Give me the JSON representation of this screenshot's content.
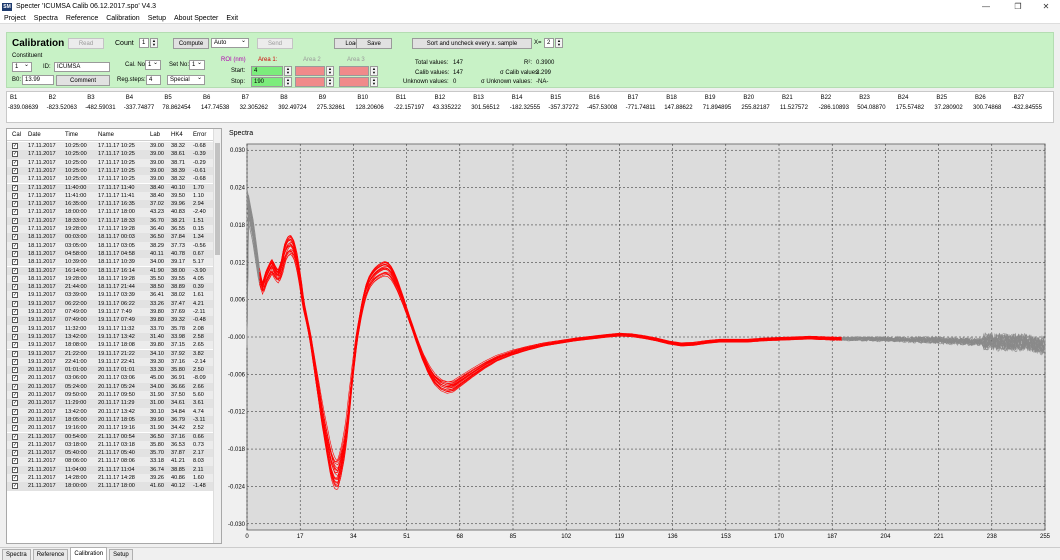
{
  "window": {
    "title": "Specter  'ICUMSA Calib 06.12.2017.spo'  V4.3",
    "icon": "SM"
  },
  "menu": [
    "Project",
    "Spectra",
    "Reference",
    "Calibration",
    "Setup",
    "About Specter",
    "Exit"
  ],
  "panel": {
    "title": "Calibration",
    "read": "Read",
    "count_label": "Count",
    "count_value": "1",
    "compute": "Compute",
    "compute_mode": "Auto",
    "send": "Send",
    "load": "Load",
    "save": "Save",
    "sort": "Sort and uncheck every x. sample",
    "x_label": "X=",
    "x_value": "2",
    "constituent_label": "Constituent",
    "constituent_value": "1",
    "id_label": "ID:",
    "id_value": "ICUMSA",
    "b0_label": "B0:",
    "b0_value": "13.99",
    "comment": "Comment",
    "calno_label": "Cal. No:",
    "calno_value": "1",
    "setno_label": "Set No:",
    "setno_value": "1",
    "regsteps_label": "Reg.steps:",
    "regsteps_value": "4",
    "special": "Special",
    "roi_label": "ROI (nm)",
    "area1": "Area 1:",
    "area2": "Area 2",
    "area3": "Area 3",
    "start_label": "Start:",
    "stop_label": "Stop:",
    "start_value": "4",
    "stop_value": "190",
    "total_label": "Total values:",
    "total_value": "147",
    "calib_label": "Calib values:",
    "calib_value": "147",
    "unknown_label": "Unknown values:",
    "unknown_value": "0",
    "r2_label": "R²:",
    "r2_value": "0.3900",
    "scalib_label": "σ Calib values:",
    "scalib_value": "3.299",
    "sunknown_label": "σ Unknown values:",
    "sunknown_value": "-NA-"
  },
  "bands": {
    "headers": [
      "B1",
      "B2",
      "B3",
      "B4",
      "B5",
      "B6",
      "B7",
      "B8",
      "B9",
      "B10",
      "B11",
      "B12",
      "B13",
      "B14",
      "B15",
      "B16",
      "B17",
      "B18",
      "B19",
      "B20",
      "B21",
      "B22",
      "B23",
      "B24",
      "B25",
      "B26",
      "B27"
    ],
    "values": [
      "-839.08639",
      "-823.52063",
      "-482.59031",
      "-337.74877",
      "78.862454",
      "147.74538",
      "32.305262",
      "392.49724",
      "275.32861",
      "128.20606",
      "-22.157197",
      "43.335222",
      "301.56512",
      "-182.32555",
      "-357.37272",
      "-457.53008",
      "-771.74811",
      "147.88622",
      "71.894895",
      "255.82187",
      "11.527572",
      "-286.10893",
      "504.08870",
      "175.57482",
      "37.280902",
      "300.74868",
      "-432.84555"
    ]
  },
  "table": {
    "columns": [
      "Cal",
      "Date",
      "Time",
      "Name",
      "Lab",
      "HK4",
      "Error"
    ],
    "rows": [
      [
        "17.11.2017",
        "10:25:00",
        "17.11.17 10:25",
        "39.00",
        "38.32",
        "-0.68"
      ],
      [
        "17.11.2017",
        "10:25:00",
        "17.11.17 10:25",
        "39.00",
        "38.61",
        "-0.39"
      ],
      [
        "17.11.2017",
        "10:25:00",
        "17.11.17 10:25",
        "39.00",
        "38.71",
        "-0.29"
      ],
      [
        "17.11.2017",
        "10:25:00",
        "17.11.17 10:25",
        "39.00",
        "38.39",
        "-0.61"
      ],
      [
        "17.11.2017",
        "10:25:00",
        "17.11.17 10:25",
        "39.00",
        "38.32",
        "-0.68"
      ],
      [
        "17.11.2017",
        "11:40:00",
        "17.11.17 11:40",
        "38.40",
        "40.10",
        "1.70"
      ],
      [
        "17.11.2017",
        "11:41:00",
        "17.11.17 11:41",
        "38.40",
        "39.50",
        "1.10"
      ],
      [
        "17.11.2017",
        "16:35:00",
        "17.11.17 16:35",
        "37.02",
        "39.96",
        "2.94"
      ],
      [
        "17.11.2017",
        "18:00:00",
        "17.11.17 18:00",
        "43.23",
        "40.83",
        "-2.40"
      ],
      [
        "17.11.2017",
        "18:33:00",
        "17.11.17 18:33",
        "36.70",
        "38.21",
        "1.51"
      ],
      [
        "17.11.2017",
        "19:28:00",
        "17.11.17 19:28",
        "36.40",
        "36.55",
        "0.15"
      ],
      [
        "18.11.2017",
        "00:03:00",
        "18.11.17 00:03",
        "36.50",
        "37.84",
        "1.34"
      ],
      [
        "18.11.2017",
        "03:05:00",
        "18.11.17 03:05",
        "38.29",
        "37.73",
        "-0.56"
      ],
      [
        "18.11.2017",
        "04:58:00",
        "18.11.17 04:58",
        "40.11",
        "40.78",
        "0.67"
      ],
      [
        "18.11.2017",
        "10:39:00",
        "18.11.17 10:39",
        "34.00",
        "39.17",
        "5.17"
      ],
      [
        "18.11.2017",
        "16:14:00",
        "18.11.17 16:14",
        "41.90",
        "38.00",
        "-3.90"
      ],
      [
        "18.11.2017",
        "19:28:00",
        "18.11.17 19:28",
        "35.50",
        "39.55",
        "4.05"
      ],
      [
        "18.11.2017",
        "21:44:00",
        "18.11.17 21:44",
        "38.50",
        "38.89",
        "0.39"
      ],
      [
        "19.11.2017",
        "03:39:00",
        "19.11.17 03:39",
        "36.41",
        "38.02",
        "1.61"
      ],
      [
        "19.11.2017",
        "06:22:00",
        "19.11.17 06:22",
        "33.26",
        "37.47",
        "4.21"
      ],
      [
        "19.11.2017",
        "07:49:00",
        "19.11.17 7:49",
        "39.80",
        "37.69",
        "-2.11"
      ],
      [
        "19.11.2017",
        "07:49:00",
        "19.11.17 07:49",
        "39.80",
        "39.32",
        "-0.48"
      ],
      [
        "19.11.2017",
        "11:32:00",
        "19.11.17 11:32",
        "33.70",
        "35.78",
        "2.08"
      ],
      [
        "19.11.2017",
        "13:42:00",
        "19.11.17 13:42",
        "31.40",
        "33.98",
        "2.58"
      ],
      [
        "19.11.2017",
        "18:08:00",
        "19.11.17 18:08",
        "39.80",
        "37.15",
        "2.65"
      ],
      [
        "19.11.2017",
        "21:22:00",
        "19.11.17 21:22",
        "34.10",
        "37.92",
        "3.82"
      ],
      [
        "19.11.2017",
        "22:41:00",
        "19.11.17 22:41",
        "39.30",
        "37.16",
        "-2.14"
      ],
      [
        "20.11.2017",
        "01:01:00",
        "20.11.17 01:01",
        "33.30",
        "35.80",
        "2.50"
      ],
      [
        "20.11.2017",
        "03:06:00",
        "20.11.17 03:06",
        "45.00",
        "36.91",
        "-8.09"
      ],
      [
        "20.11.2017",
        "05:24:00",
        "20.11.17 05:24",
        "34.00",
        "36.66",
        "2.66"
      ],
      [
        "20.11.2017",
        "09:50:00",
        "20.11.17 09:50",
        "31.90",
        "37.50",
        "5.60"
      ],
      [
        "20.11.2017",
        "11:29:00",
        "20.11.17 11:29",
        "31.00",
        "34.61",
        "3.61"
      ],
      [
        "20.11.2017",
        "13:42:00",
        "20.11.17 13:42",
        "30.10",
        "34.84",
        "4.74"
      ],
      [
        "20.11.2017",
        "18:05:00",
        "20.11.17 18:05",
        "39.90",
        "36.79",
        "-3.11"
      ],
      [
        "20.11.2017",
        "19:16:00",
        "20.11.17 19:16",
        "31.90",
        "34.42",
        "2.52"
      ],
      [
        "21.11.2017",
        "00:54:00",
        "21.11.17 00:54",
        "36.50",
        "37.16",
        "0.66"
      ],
      [
        "21.11.2017",
        "03:18:00",
        "21.11.17 03:18",
        "35.80",
        "36.53",
        "0.73"
      ],
      [
        "21.11.2017",
        "05:40:00",
        "21.11.17 05:40",
        "35.70",
        "37.87",
        "2.17"
      ],
      [
        "21.11.2017",
        "08:06:00",
        "21.11.17 08:06",
        "33.18",
        "41.21",
        "8.03"
      ],
      [
        "21.11.2017",
        "11:04:00",
        "21.11.17 11:04",
        "36.74",
        "38.85",
        "2.11"
      ],
      [
        "21.11.2017",
        "14:28:00",
        "21.11.17 14:28",
        "39.26",
        "40.86",
        "1.60"
      ],
      [
        "21.11.2017",
        "18:00:00",
        "21.11.17 18:00",
        "41.60",
        "40.12",
        "-1.48"
      ]
    ]
  },
  "chart_data": {
    "type": "line",
    "title": "Spectra",
    "xlim": [
      0,
      255
    ],
    "ylim": [
      -0.031,
      0.031
    ],
    "xticks": [
      0,
      17,
      34,
      51,
      68,
      85,
      102,
      119,
      136,
      153,
      170,
      187,
      204,
      221,
      238,
      255
    ],
    "yticks": [
      0.03,
      0.024,
      0.018,
      0.012,
      0.006,
      0.0,
      -0.006,
      -0.012,
      -0.018,
      -0.024,
      -0.03
    ],
    "yticklabels": [
      "0.030",
      "0.024",
      "0.018",
      "0.012",
      "0.006",
      "-0.000",
      "-0.006",
      "-0.012",
      "-0.018",
      "-0.024",
      "-0.030"
    ],
    "roi": [
      4,
      190
    ],
    "series_color": "#ff0000",
    "outside_color": "#8a8a8a",
    "curve": [
      [
        0,
        0.022
      ],
      [
        2,
        0.017
      ],
      [
        4,
        0.0098
      ],
      [
        5,
        0.0078
      ],
      [
        6,
        0.0095
      ],
      [
        8,
        0.0115
      ],
      [
        9,
        0.0105
      ],
      [
        10,
        0.0098
      ],
      [
        11,
        0.011
      ],
      [
        12,
        0.0135
      ],
      [
        13,
        0.0146
      ],
      [
        14,
        0.015
      ],
      [
        15,
        0.0142
      ],
      [
        16,
        0.0122
      ],
      [
        17,
        0.0093
      ],
      [
        18,
        0.0055
      ],
      [
        20,
        0.0005
      ],
      [
        22,
        -0.006
      ],
      [
        24,
        -0.0125
      ],
      [
        26,
        -0.018
      ],
      [
        27,
        -0.0205
      ],
      [
        28,
        -0.0219
      ],
      [
        29,
        -0.0222
      ],
      [
        30,
        -0.0205
      ],
      [
        31,
        -0.018
      ],
      [
        32,
        -0.0145
      ],
      [
        33,
        -0.0095
      ],
      [
        34,
        -0.0048
      ],
      [
        35,
        -0.0005
      ],
      [
        36,
        0.0028
      ],
      [
        37,
        0.0055
      ],
      [
        38,
        0.0075
      ],
      [
        39,
        0.0088
      ],
      [
        40,
        0.0096
      ],
      [
        41,
        0.0102
      ],
      [
        42,
        0.0106
      ],
      [
        43,
        0.0109
      ],
      [
        44,
        0.0111
      ],
      [
        45,
        0.011
      ],
      [
        46,
        0.0105
      ],
      [
        47,
        0.0096
      ],
      [
        48,
        0.0085
      ],
      [
        50,
        0.0058
      ],
      [
        52,
        0.0028
      ],
      [
        54,
        -0.0002
      ],
      [
        56,
        -0.003
      ],
      [
        58,
        -0.0052
      ],
      [
        60,
        -0.0068
      ],
      [
        62,
        -0.0077
      ],
      [
        64,
        -0.0081
      ],
      [
        66,
        -0.0079
      ],
      [
        68,
        -0.0072
      ],
      [
        72,
        -0.0058
      ],
      [
        76,
        -0.0045
      ],
      [
        80,
        -0.0034
      ],
      [
        85,
        -0.0025
      ],
      [
        90,
        -0.0018
      ],
      [
        95,
        -0.0012
      ],
      [
        100,
        -0.0008
      ],
      [
        105,
        -0.0004
      ],
      [
        110,
        -0.0001
      ],
      [
        115,
        0.0002
      ],
      [
        119,
        0.0004
      ],
      [
        123,
        0.0003
      ],
      [
        127,
        0.0
      ],
      [
        131,
        -0.0004
      ],
      [
        135,
        -0.0009
      ],
      [
        139,
        -0.0012
      ],
      [
        143,
        -0.0011
      ],
      [
        147,
        -0.0008
      ],
      [
        151,
        -0.0006
      ],
      [
        155,
        -0.0006
      ],
      [
        160,
        -0.0006
      ],
      [
        165,
        -0.0004
      ],
      [
        170,
        -0.0003
      ],
      [
        175,
        -0.0002
      ],
      [
        180,
        -0.0001
      ],
      [
        185,
        -0.0002
      ],
      [
        190,
        -0.0003
      ],
      [
        200,
        -0.0003
      ],
      [
        210,
        -0.0004
      ],
      [
        220,
        -0.0005
      ],
      [
        230,
        -0.0007
      ],
      [
        240,
        -0.0008
      ],
      [
        248,
        -0.0008
      ],
      [
        252,
        -0.0012
      ],
      [
        255,
        -0.0014
      ]
    ]
  }
}
